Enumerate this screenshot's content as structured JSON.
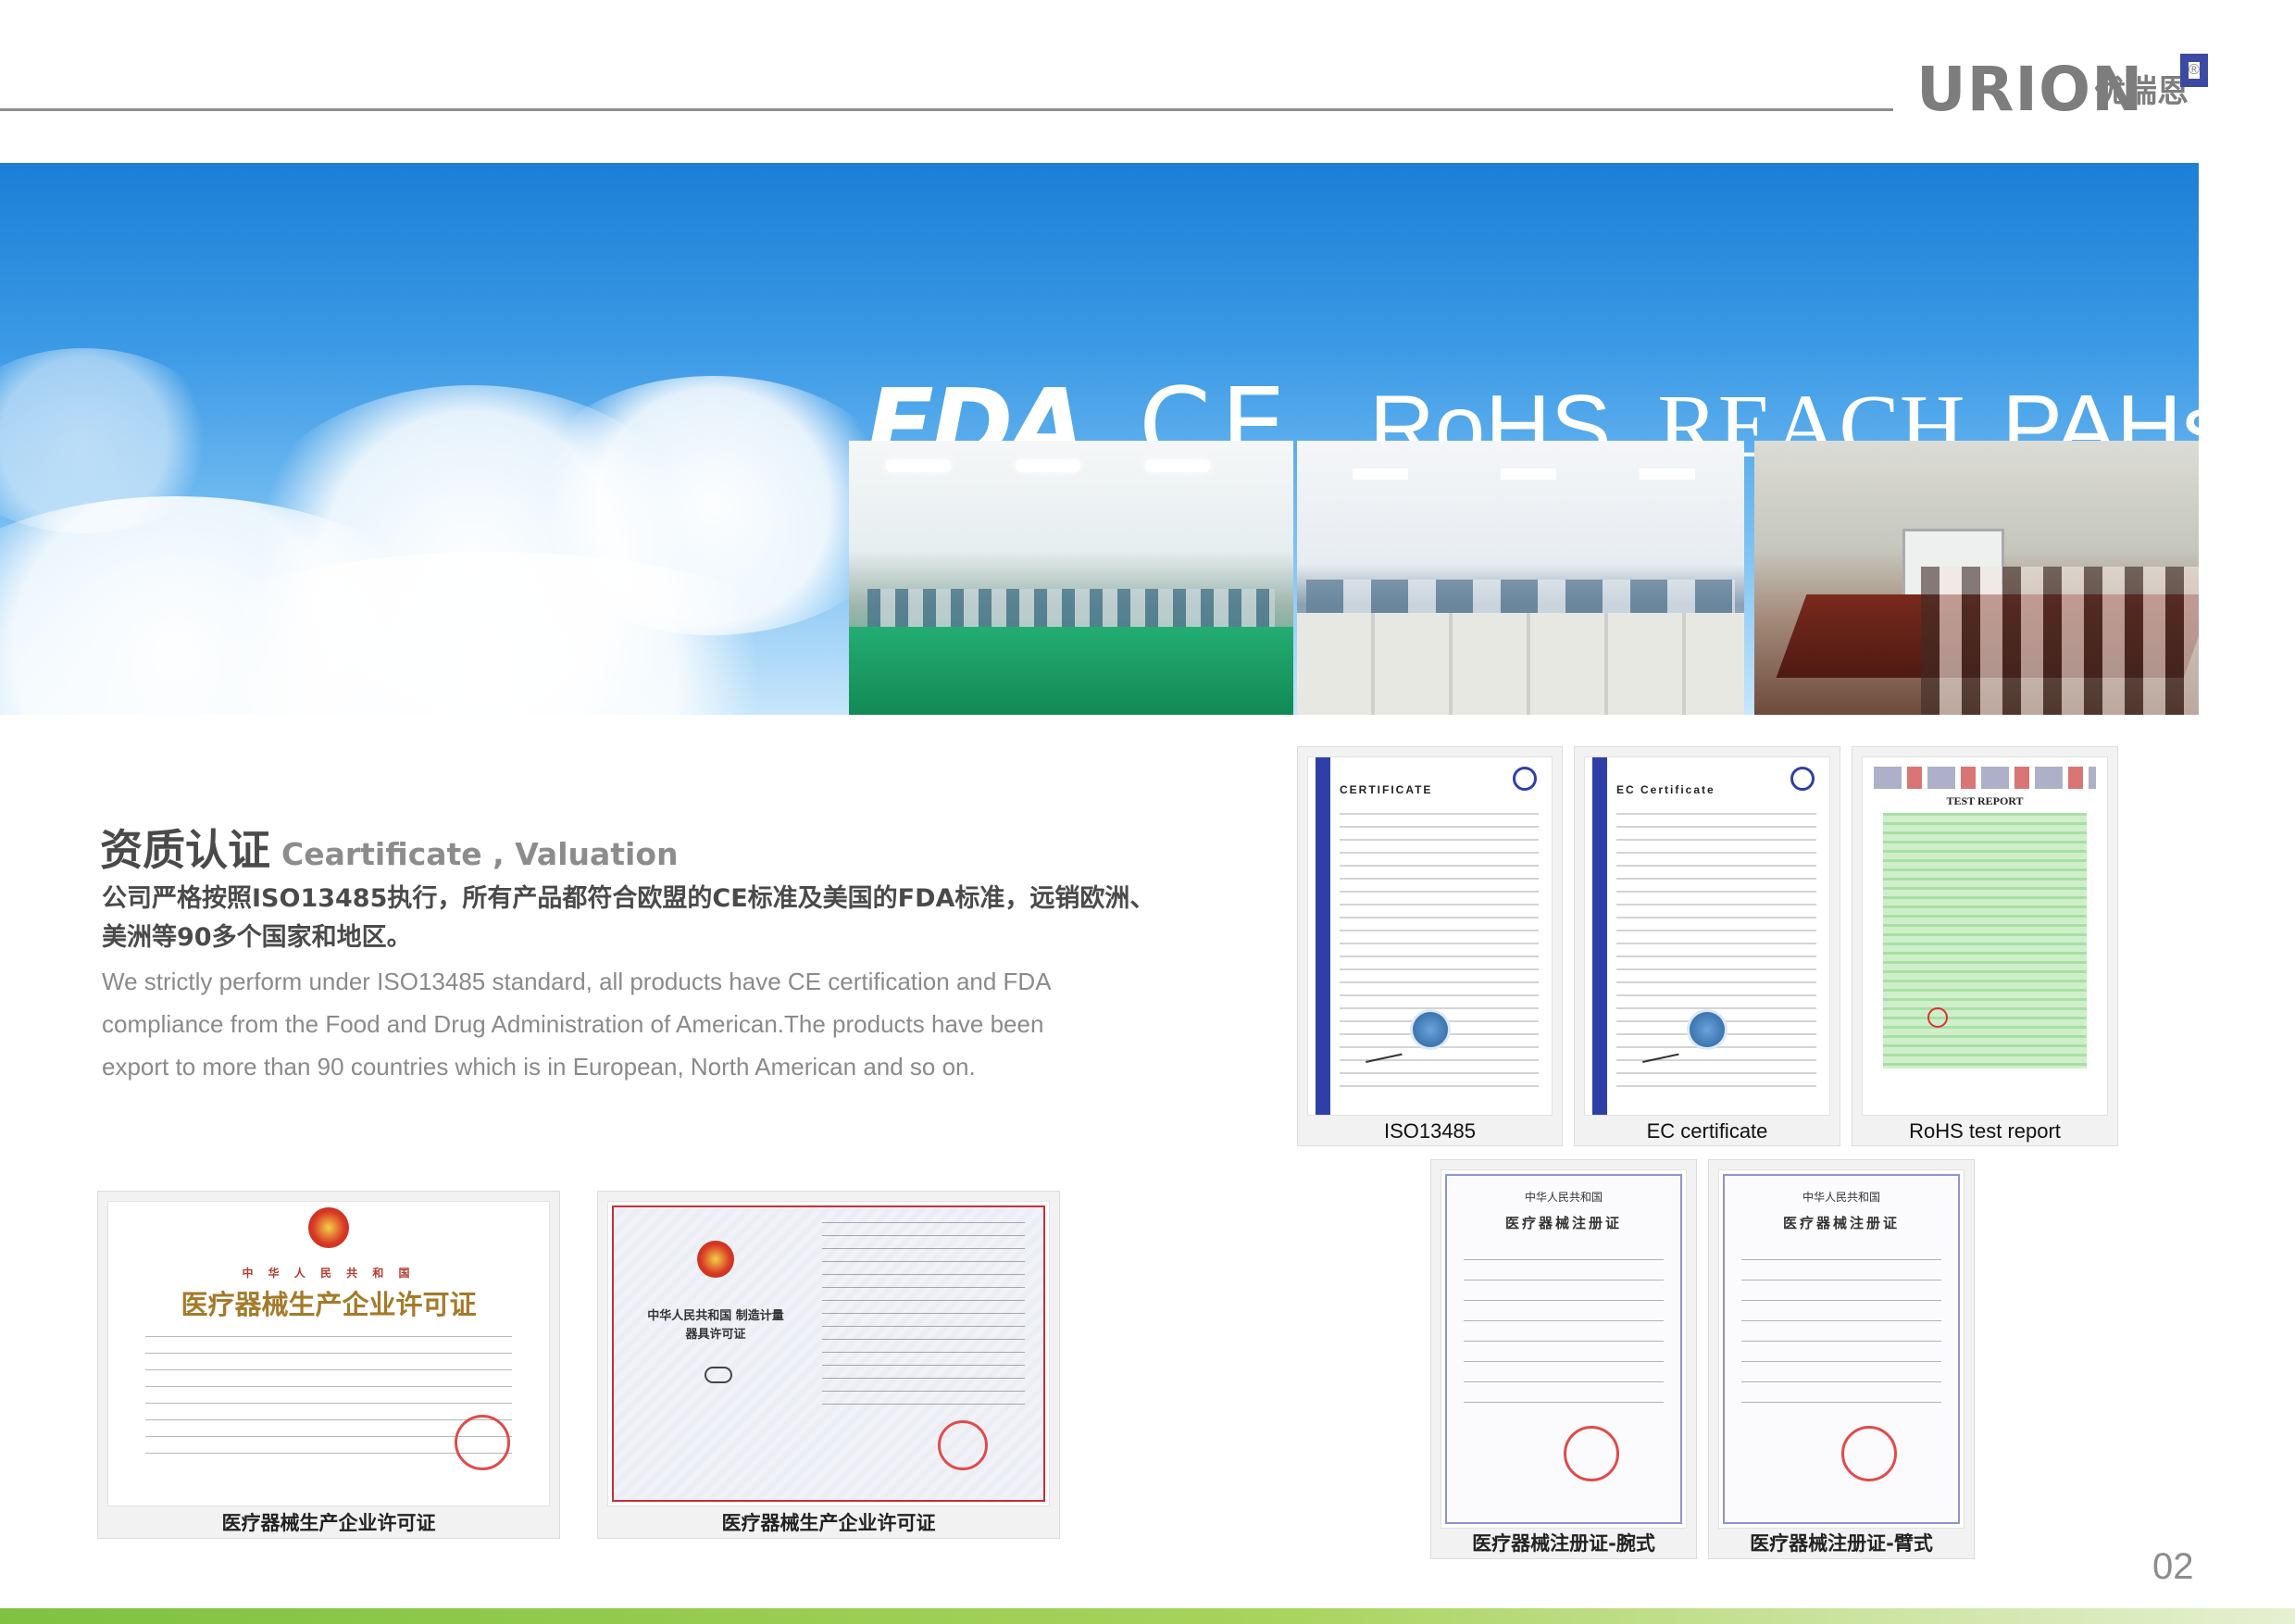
{
  "brand": {
    "wordmark": "URION",
    "cn_name": "优瑞恩",
    "registered": "®"
  },
  "banner": {
    "standards": [
      "FDA",
      "CE",
      "RoHS",
      "REACH",
      "PAHs"
    ]
  },
  "section": {
    "title_cn": "资质认证",
    "title_en": "Ceartificate , Valuation",
    "paragraph_cn": "公司严格按照ISO13485执行，所有产品都符合欧盟的CE标准及美国的FDA标准，远销欧洲、美洲等90多个国家和地区。",
    "paragraph_en_lines": [
      "We strictly perform under ISO13485 standard, all products have CE certification and FDA",
      "compliance from the Food and Drug Administration of American.The products have been",
      "export to more than 90 countries which is in European, North American and so on."
    ]
  },
  "certificates": [
    {
      "caption": "ISO13485",
      "doc_title": "CERTIFICATE"
    },
    {
      "caption": "EC certificate",
      "doc_title": "EC Certificate"
    },
    {
      "caption": "RoHS test report",
      "doc_title": "TEST REPORT"
    },
    {
      "caption": "医疗器械生产企业许可证",
      "doc_title": "医疗器械生产企业许可证",
      "doc_header": "中 华 人 民 共 和 国"
    },
    {
      "caption": "医疗器械生产企业许可证",
      "doc_title": "中华人民共和国 制造计量器具许可证"
    },
    {
      "caption": "医疗器械注册证-腕式",
      "doc_header": "中华人民共和国",
      "doc_title": "医疗器械注册证"
    },
    {
      "caption": "医疗器械注册证-臂式",
      "doc_header": "中华人民共和国",
      "doc_title": "医疗器械注册证"
    }
  ],
  "page_number": "02",
  "colors": {
    "sky_blue": "#3d9be6",
    "brand_grey": "#7d7d7d",
    "accent_green": "#7fc241"
  }
}
